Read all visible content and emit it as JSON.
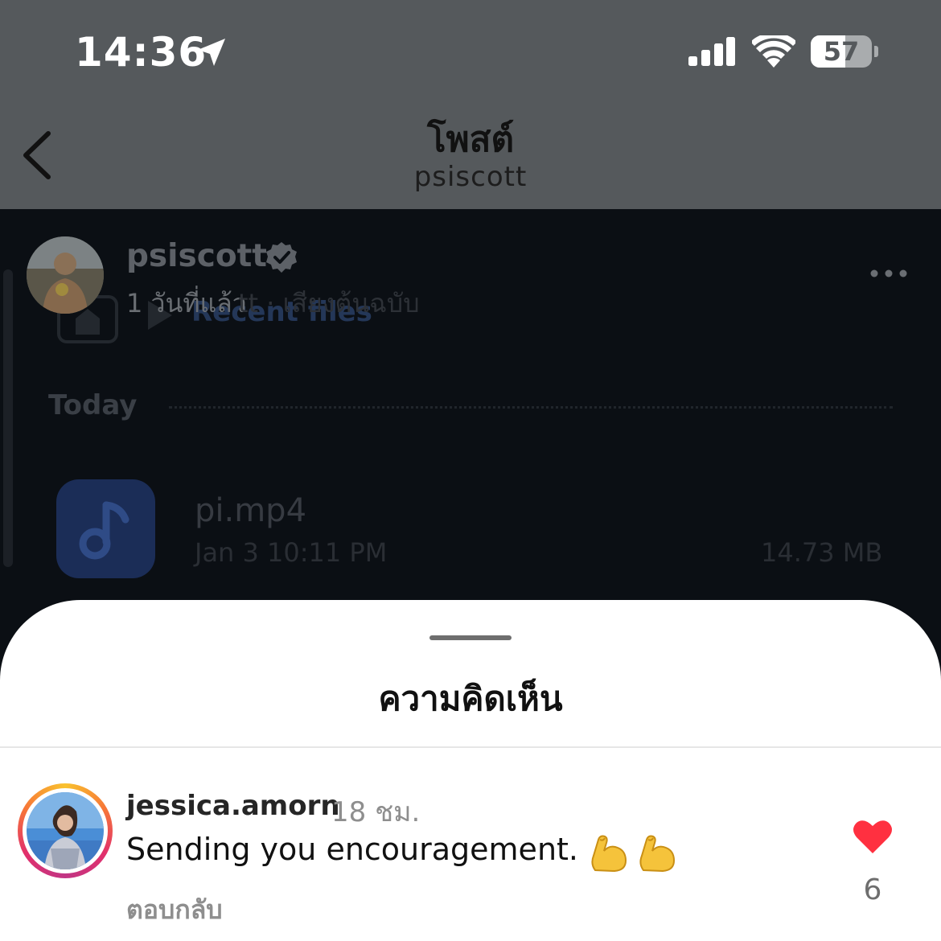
{
  "status_bar": {
    "time": "14:36",
    "battery_level": "57",
    "battery_fraction": 0.57,
    "location_icon": "location-arrow-icon",
    "signal_icon": "cellular-signal-icon",
    "wifi_icon": "wifi-icon"
  },
  "header": {
    "title": "โพสต์",
    "subtitle": "psiscott",
    "back_icon": "chevron-left-icon"
  },
  "post": {
    "username": "psiscott",
    "time_ago": "1 วันที่แล้ว",
    "audio_text": "tt · เสียงต้นฉบับ",
    "verified_icon": "verified-badge-icon",
    "more_icon": "more-horizontal-icon"
  },
  "background": {
    "recent_files": "Recent files",
    "today": "Today",
    "file_name": "pi.mp4",
    "file_date": "Jan 3 10:11 PM",
    "file_size": "14.73 MB"
  },
  "sheet": {
    "title": "ความคิดเห็น"
  },
  "comment": {
    "username": "jessica.amorn",
    "time": "18 ชม.",
    "text": "Sending you encouragement.",
    "emoji": "flexed-biceps-emoji",
    "reply_label": "ตอบกลับ",
    "like_count": "6",
    "liked_color": "#ff3040"
  }
}
